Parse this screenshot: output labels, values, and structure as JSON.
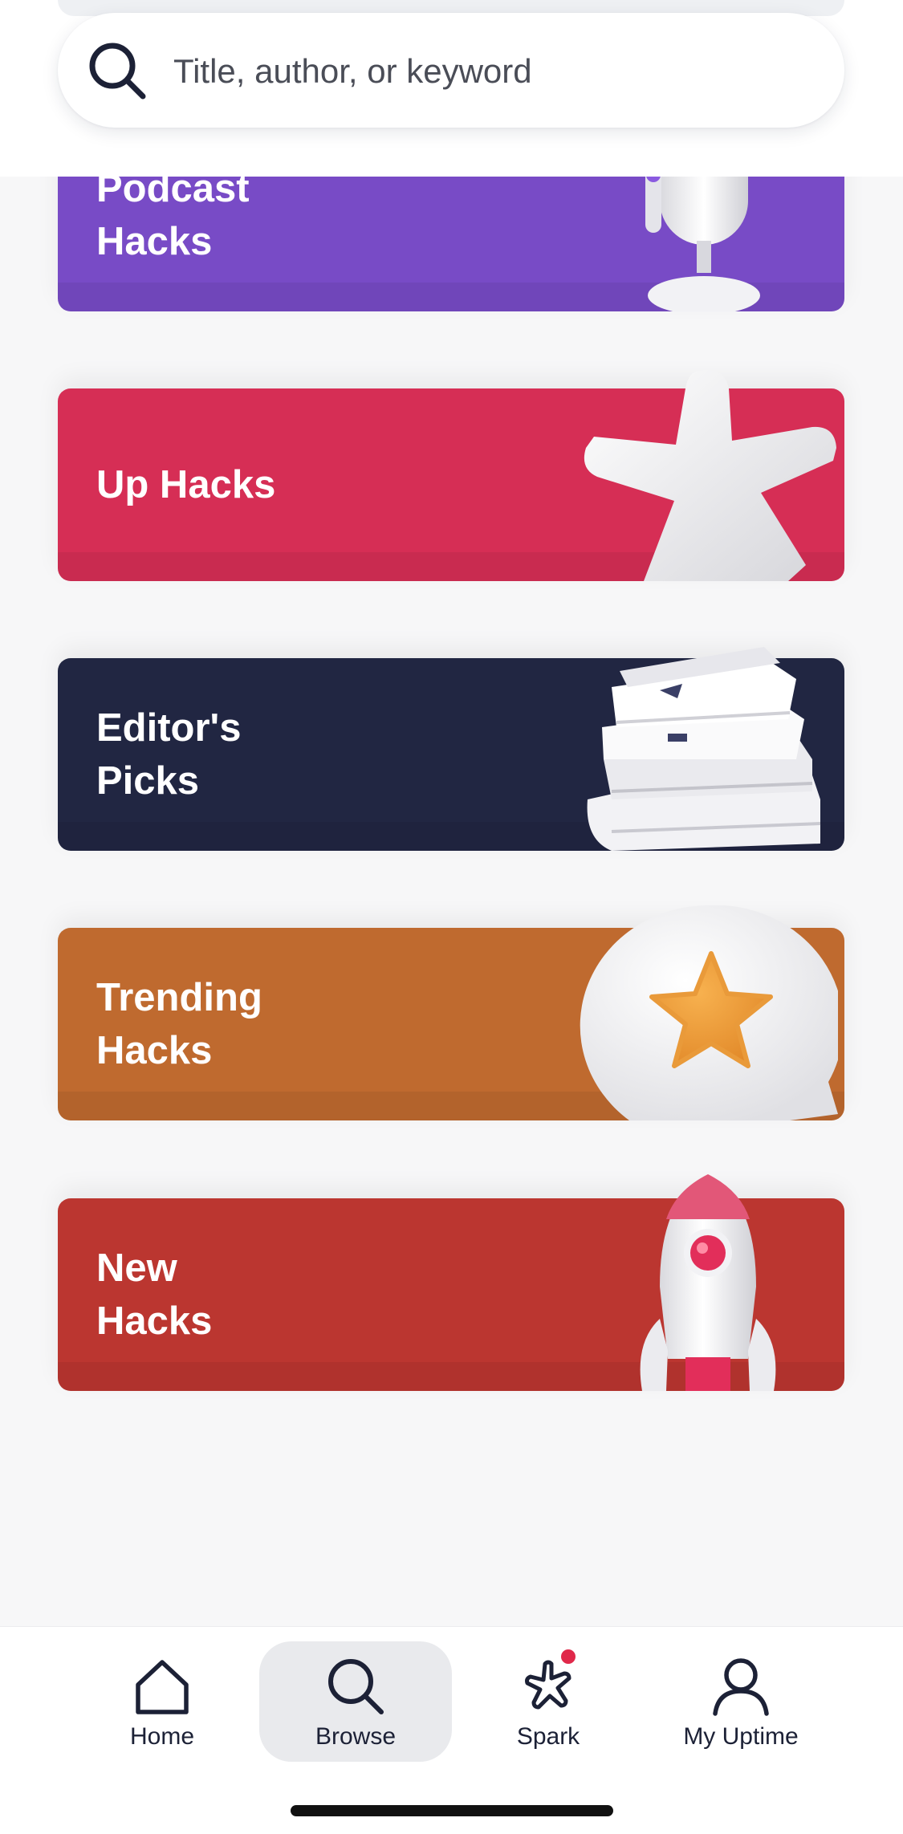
{
  "search": {
    "placeholder": "Title, author, or keyword",
    "icon": "search-icon"
  },
  "categories": [
    {
      "label": "Podcast\nHacks",
      "color": "#784bc6",
      "icon": "microphone-icon"
    },
    {
      "label": "Up Hacks",
      "color": "#d62e55",
      "icon": "asterisk-star-icon"
    },
    {
      "label": "Editor's\nPicks",
      "color": "#212642",
      "icon": "book-stack-icon"
    },
    {
      "label": "Trending\nHacks",
      "color": "#bf6a2f",
      "icon": "star-bubble-icon"
    },
    {
      "label": "New\nHacks",
      "color": "#bb3630",
      "icon": "rocket-icon"
    }
  ],
  "tab_bar": {
    "tabs": [
      {
        "label": "Home",
        "icon": "home-icon",
        "active": false
      },
      {
        "label": "Browse",
        "icon": "search-icon",
        "active": true
      },
      {
        "label": "Spark",
        "icon": "spark-icon",
        "active": false,
        "badge": true
      },
      {
        "label": "My Uptime",
        "icon": "user-icon",
        "active": false
      }
    ],
    "badge_color": "#e0284a"
  }
}
